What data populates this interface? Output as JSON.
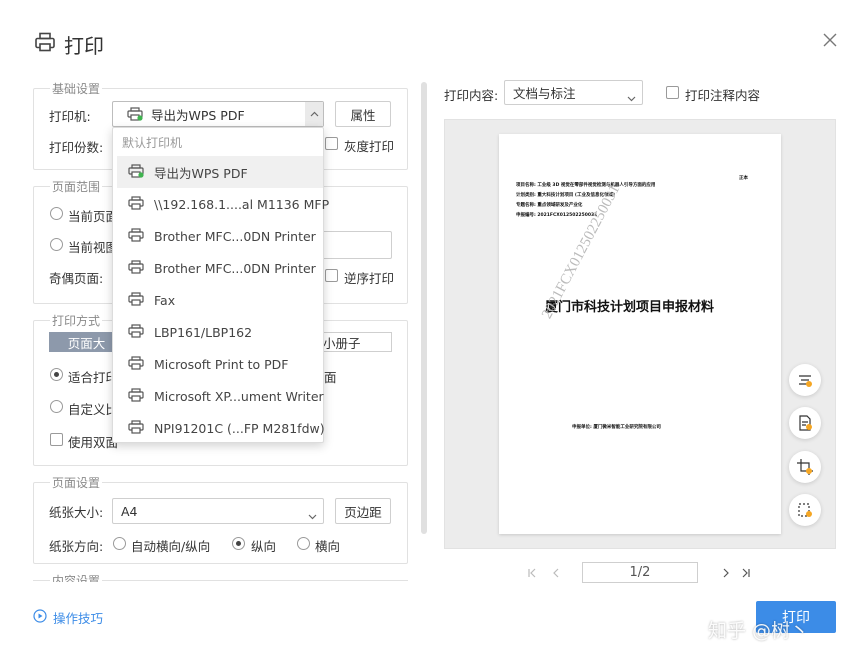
{
  "dialog": {
    "title": "打印"
  },
  "basic": {
    "section_title": "基础设置",
    "printer_label": "打印机:",
    "printer_value": "导出为WPS PDF",
    "properties_btn": "属性",
    "copies_label": "打印份数:",
    "grayscale_label": "灰度打印"
  },
  "printer_menu": {
    "header": "默认打印机",
    "items": [
      "导出为WPS PDF",
      "\\\\192.168.1....al M1136 MFP",
      "Brother MFC...0DN Printer",
      "Brother MFC...0DN Printer",
      "Fax",
      "LBP161/LBP162",
      "Microsoft Print to PDF",
      "Microsoft XP...ument Writer",
      "NPI91201C (...FP M281fdw)"
    ]
  },
  "range": {
    "section_title": "页面范围",
    "current_page": "当前页面",
    "current_view": "当前视图",
    "odd_even_label": "奇偶页面:",
    "reverse_label": "逆序打印"
  },
  "method": {
    "section_title": "打印方式",
    "tab_page": "页面大",
    "tab_booklet": "小册子",
    "fit_label": "适合打印",
    "fit_suffix": "面",
    "custom_label": "自定义比",
    "duplex_label": "使用双面"
  },
  "page_setup": {
    "section_title": "页面设置",
    "paper_size_label": "纸张大小:",
    "paper_size_value": "A4",
    "margin_btn": "页边距",
    "orientation_label": "纸张方向:",
    "auto_orient": "自动横向/纵向",
    "portrait": "纵向",
    "landscape": "横向"
  },
  "content_setup": {
    "section_title": "内容设置"
  },
  "footer": {
    "tips_label": "操作技巧",
    "print_btn": "打印"
  },
  "preview": {
    "content_label": "打印内容:",
    "content_value": "文档与标注",
    "annot_label": "打印注释内容",
    "page_indicator": "1/2",
    "doc_title": "厦门市科技计划项目申报材料",
    "watermark": "2021FCX012502250031",
    "corner_mark": "正本",
    "lines": [
      "项目名称: 工业级 3D 视觉在零部件视觉检测与机器人引导方面的应用",
      "计划类别: 重大科技计划项目 (工业及信息化领域)",
      "专题名称: 重点领域研发及产业化",
      "申报编号: 2021FCX012502250031"
    ],
    "applicant": "申报单位: 厦门微米智能工业研究院有限公司"
  },
  "watermark_text": "知乎 @树丶",
  "colors": {
    "accent": "#3c8ce7",
    "tab_dark": "#8d99ab"
  }
}
